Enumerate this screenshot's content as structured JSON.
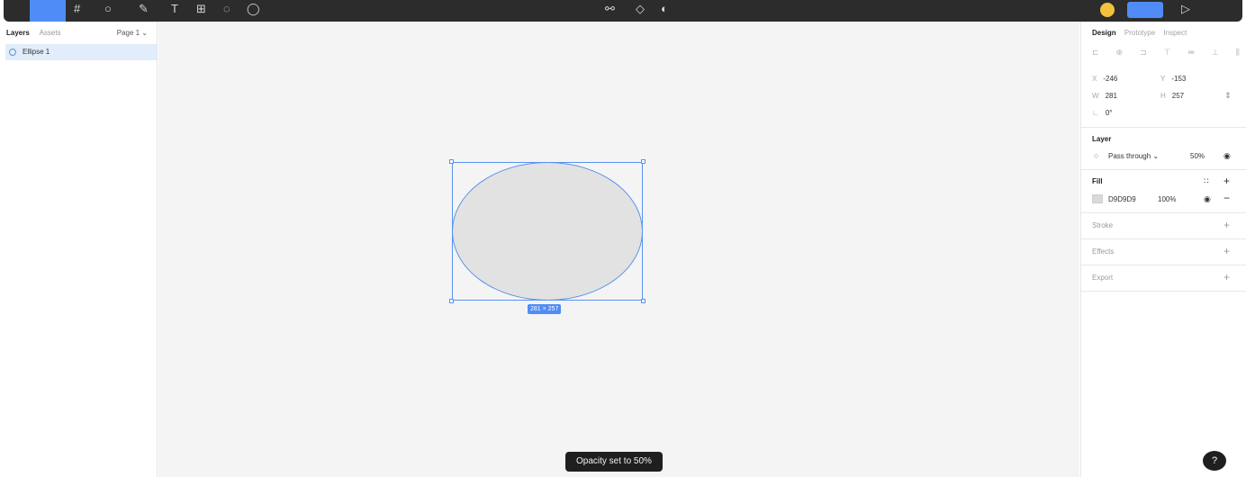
{
  "left_panel": {
    "tabs": [
      "Layers",
      "Assets"
    ],
    "page": "Page 1 ⌄",
    "layer_item": {
      "label": "Ellipse 1",
      "icon": "ellipse-icon"
    }
  },
  "canvas": {
    "shape": "ellipse",
    "fill_color": "#D9D9D9",
    "selection_color": "#4F8CF7",
    "size_badge": "281 × 257",
    "toast": "Opacity set to 50%"
  },
  "right_panel": {
    "tabs": [
      "Design",
      "Prototype",
      "Inspect"
    ],
    "x_label": "X",
    "x_value": "-246",
    "y_label": "Y",
    "y_value": "-153",
    "w_label": "W",
    "w_value": "281",
    "h_label": "H",
    "h_value": "257",
    "rotation_value": "0°",
    "layer": {
      "title": "Layer",
      "blend_mode": "Pass through ⌄",
      "opacity": "50%"
    },
    "fill": {
      "title": "Fill",
      "hex": "D9D9D9",
      "opacity": "100%"
    },
    "stroke_title": "Stroke",
    "effects_title": "Effects",
    "export_title": "Export",
    "help": "?"
  }
}
